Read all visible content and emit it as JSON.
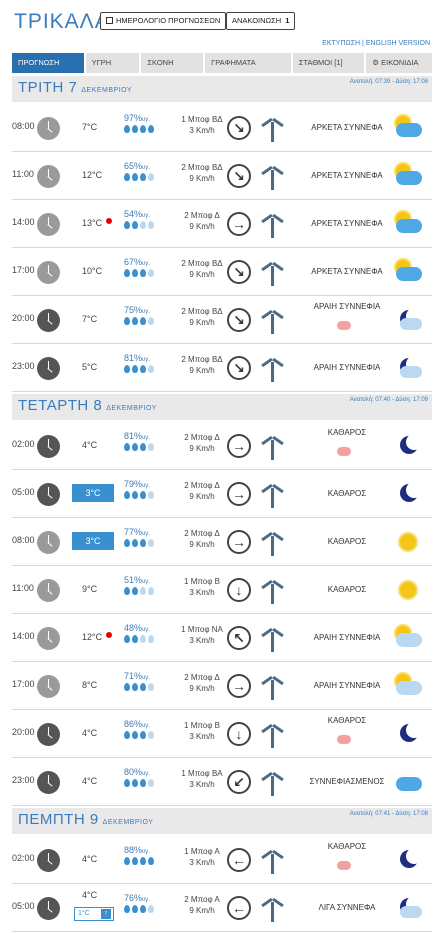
{
  "header": {
    "city": "ΤΡΙΚΑΛΑ",
    "calendar_button": "ΗΜΕΡΟΛΟΓΙΟ ΠΡΟΓΝΩΣΕΩΝ",
    "announcements_button": "ΑΝΑΚΟΙΝΩΣΗ",
    "announcements_count": "1",
    "links": "ΕΚΤΥΠΩΣΗ | ENGLISH VERSION"
  },
  "tabs": [
    "ΠΡΟΓΝΩΣΗ",
    "ΥΓΡΗ",
    "ΣΚΟΝΗ",
    "ΓΡΑΦΗΜΑΤΑ",
    "ΣΤΑΘΜΟΙ [1]",
    "⚙ ΕΙΚΟΝΙΔΙΑ"
  ],
  "active_tab": "ΠΡΟΓΝΩΣΗ",
  "days": [
    {
      "name": "ΤΡΙΤΗ 7",
      "month": "ΔΕΚΕΜΒΡΙΟΥ",
      "sun": "Ανατολή: 07:39 - Δύση: 17:08",
      "rows": [
        {
          "time": "08:00",
          "night": false,
          "temp": "7°C",
          "hum": "97%",
          "hum_unit": "υγ.",
          "wind1": "1 Μποφ ΒΔ",
          "wind2": "3 Km/h",
          "arrow": "↘",
          "cond": "ΑΡΚΕΤΑ ΣΥΝΝΕΦΑ",
          "icon": "partly-cloudy-day-icon"
        },
        {
          "time": "11:00",
          "night": false,
          "temp": "12°C",
          "hum": "65%",
          "hum_unit": "υγ.",
          "wind1": "2 Μποφ ΒΔ",
          "wind2": "9 Km/h",
          "arrow": "↘",
          "cond": "ΑΡΚΕΤΑ ΣΥΝΝΕΦΑ",
          "icon": "partly-cloudy-day-icon"
        },
        {
          "time": "14:00",
          "night": false,
          "temp": "13°C",
          "hum": "54%",
          "hum_unit": "υγ.",
          "wind1": "2 Μποφ Δ",
          "wind2": "9 Km/h",
          "arrow": "→",
          "cond": "ΑΡΚΕΤΑ ΣΥΝΝΕΦΑ",
          "icon": "partly-cloudy-day-icon"
        },
        {
          "time": "17:00",
          "night": false,
          "temp": "10°C",
          "hum": "67%",
          "hum_unit": "υγ.",
          "wind1": "2 Μποφ ΒΔ",
          "wind2": "9 Km/h",
          "arrow": "↘",
          "cond": "ΑΡΚΕΤΑ ΣΥΝΝΕΦΑ",
          "icon": "partly-cloudy-day-icon"
        },
        {
          "time": "20:00",
          "night": true,
          "temp": "7°C",
          "hum": "75%",
          "hum_unit": "υγ.",
          "wind1": "2 Μποφ ΒΔ",
          "wind2": "9 Km/h",
          "arrow": "↘",
          "cond": "ΑΡΑΙΗ ΣΥΝΝΕΦΙΑ",
          "icon": "partly-cloudy-night-icon"
        },
        {
          "time": "23:00",
          "night": true,
          "temp": "5°C",
          "hum": "81%",
          "hum_unit": "υγ.",
          "wind1": "2 Μποφ ΒΔ",
          "wind2": "9 Km/h",
          "arrow": "↘",
          "cond": "ΑΡΑΙΗ ΣΥΝΝΕΦΙΑ",
          "icon": "partly-cloudy-night-icon"
        }
      ]
    },
    {
      "name": "ΤΕΤΑΡΤΗ 8",
      "month": "ΔΕΚΕΜΒΡΙΟΥ",
      "sun": "Ανατολή: 07:40 - Δύση: 17:09",
      "rows": [
        {
          "time": "02:00",
          "night": true,
          "temp": "4°C",
          "hum": "81%",
          "hum_unit": "υγ.",
          "wind1": "2 Μποφ Δ",
          "wind2": "9 Km/h",
          "arrow": "→",
          "cond": "ΚΑΘΑΡΟΣ",
          "icon": "moon-icon"
        },
        {
          "time": "05:00",
          "night": true,
          "temp": "3°C",
          "hum": "79%",
          "hum_unit": "υγ.",
          "wind1": "2 Μποφ Δ",
          "wind2": "9 Km/h",
          "arrow": "→",
          "cond": "ΚΑΘΑΡΟΣ",
          "icon": "moon-icon"
        },
        {
          "time": "08:00",
          "night": false,
          "temp": "3°C",
          "hum": "77%",
          "hum_unit": "υγ.",
          "wind1": "2 Μποφ Δ",
          "wind2": "9 Km/h",
          "arrow": "→",
          "cond": "ΚΑΘΑΡΟΣ",
          "icon": "sun-icon"
        },
        {
          "time": "11:00",
          "night": false,
          "temp": "9°C",
          "hum": "51%",
          "hum_unit": "υγ.",
          "wind1": "1 Μποφ Β",
          "wind2": "3 Km/h",
          "arrow": "↓",
          "cond": "ΚΑΘΑΡΟΣ",
          "icon": "sun-icon"
        },
        {
          "time": "14:00",
          "night": false,
          "temp": "12°C",
          "hum": "48%",
          "hum_unit": "υγ.",
          "wind1": "1 Μποφ ΝΑ",
          "wind2": "3 Km/h",
          "arrow": "↖",
          "cond": "ΑΡΑΙΗ ΣΥΝΝΕΦΙΑ",
          "icon": "sun-cloud-icon"
        },
        {
          "time": "17:00",
          "night": false,
          "temp": "8°C",
          "hum": "71%",
          "hum_unit": "υγ.",
          "wind1": "2 Μποφ Δ",
          "wind2": "9 Km/h",
          "arrow": "→",
          "cond": "ΑΡΑΙΗ ΣΥΝΝΕΦΙΑ",
          "icon": "sun-cloud-icon"
        },
        {
          "time": "20:00",
          "night": true,
          "temp": "4°C",
          "hum": "86%",
          "hum_unit": "υγ.",
          "wind1": "1 Μποφ Β",
          "wind2": "3 Km/h",
          "arrow": "↓",
          "cond": "ΚΑΘΑΡΟΣ",
          "icon": "moon-icon"
        },
        {
          "time": "23:00",
          "night": true,
          "temp": "4°C",
          "hum": "80%",
          "hum_unit": "υγ.",
          "wind1": "1 Μποφ ΒΑ",
          "wind2": "3 Km/h",
          "arrow": "↙",
          "cond": "ΣΥΝΝΕΦΙΑΣΜΕΝΟΣ",
          "icon": "cloudy-icon"
        }
      ]
    },
    {
      "name": "ΠΕΜΠΤΗ 9",
      "month": "ΔΕΚΕΜΒΡΙΟΥ",
      "sun": "Ανατολή: 07:41 - Δύση: 17:08",
      "rows": [
        {
          "time": "02:00",
          "night": true,
          "temp": "4°C",
          "hum": "88%",
          "hum_unit": "υγ.",
          "wind1": "1 Μποφ Α",
          "wind2": "3 Km/h",
          "arrow": "←",
          "cond": "ΚΑΘΑΡΟΣ",
          "icon": "moon-icon"
        },
        {
          "time": "05:00",
          "night": true,
          "temp": "4°C",
          "frost": "1°C",
          "hum": "76%",
          "hum_unit": "υγ.",
          "wind1": "2 Μποφ Α",
          "wind2": "9 Km/h",
          "arrow": "←",
          "cond": "ΛΙΓΑ ΣΥΝΝΕΦΑ",
          "icon": "partly-cloudy-night-icon"
        }
      ]
    }
  ]
}
